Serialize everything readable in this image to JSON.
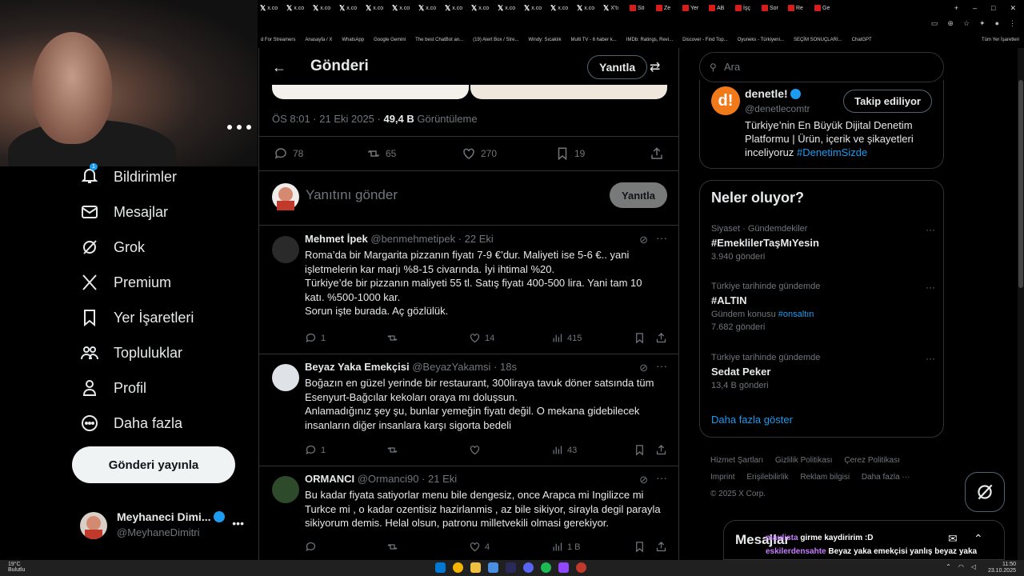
{
  "browser": {
    "tabs": [
      "x.co",
      "x.co",
      "x.co",
      "x.co",
      "x.co",
      "x.co",
      "x.co",
      "x.co",
      "x.co",
      "x.co",
      "x.co",
      "x.co",
      "x.co",
      "X'tı",
      "Sö",
      "Ze",
      "Yer",
      "AB",
      "İşç",
      "Sor",
      "Re",
      "Ge"
    ],
    "bookmarks": [
      "d For Streamers",
      "Anasayfa / X",
      "WhatsApp",
      "Google Gemini",
      "The best ChatBot an...",
      "(19) Alert Box / Stre...",
      "Windy: Sıcaklık",
      "Multi TV - 6 haber k...",
      "IMDb: Ratings, Revi...",
      "Discover - Find Top...",
      "Oyuneks - Türkiyeni...",
      "SEÇİM SONUÇLARI...",
      "ChatGPT"
    ],
    "all_bookmarks": "Tüm Yer İşaretleri"
  },
  "nav": {
    "items": [
      {
        "label": "Bildirimler",
        "badge": "1"
      },
      {
        "label": "Mesajlar"
      },
      {
        "label": "Grok"
      },
      {
        "label": "Premium"
      },
      {
        "label": "Yer İşaretleri"
      },
      {
        "label": "Topluluklar"
      },
      {
        "label": "Profil"
      },
      {
        "label": "Daha fazla"
      }
    ],
    "post_button": "Gönderi yayınla",
    "account": {
      "name": "Meyhaneci Dimi...",
      "handle": "@MeyhaneDimitri"
    }
  },
  "main": {
    "title": "Gönderi",
    "reply_chip": "Yanıtla",
    "meta_time": "ÖS 8:01 · 21 Eki 2025 · ",
    "meta_views": "49,4 B",
    "meta_views_label": " Görüntüleme",
    "actions": {
      "replies": "78",
      "reposts": "65",
      "likes": "270",
      "bookmarks": "19"
    },
    "reply_placeholder": "Yanıtını gönder",
    "reply_button": "Yanıtla",
    "tweets": [
      {
        "name": "Mehmet İpek",
        "handle": "@benmehmetipek · 22 Eki",
        "lines": [
          "Roma’da bir Margarita pizzanın fiyatı 7-9 €’dur. Maliyeti ise 5-6 €.. yani",
          "işletmelerin kar marjı %8-15 civarında. İyi ihtimal %20.",
          "Türkiye’de bir pizzanın maliyeti 55 tl. Satış fiyatı 400-500 lira. Yani tam 10",
          "katı. %500-1000 kar.",
          "Sorun işte burada. Aç gözlülük."
        ],
        "replies": "1",
        "reposts": "",
        "likes": "14",
        "views": "415"
      },
      {
        "name": "Beyaz Yaka Emekçisi",
        "handle": "@BeyazYakamsi · 18s",
        "lines": [
          "Boğazın en güzel yerinde bir restaurant, 300liraya tavuk döner satsında tüm",
          "Esenyurt-Bağcılar kekoları oraya mı doluşsun.",
          "Anlamadığınız şey şu, bunlar yemeğin fiyatı değil. O mekana gidebilecek",
          "insanların diğer insanlara karşı sigorta bedeli"
        ],
        "replies": "1",
        "reposts": "",
        "likes": "",
        "views": "43"
      },
      {
        "name": "ORMANCI",
        "handle": "@Ormanci90 · 21 Eki",
        "lines": [
          "Bu kadar fiyata satiyorlar menu bile dengesiz, once Arapca mi Ingilizce mi",
          "Turkce mi , o kadar ozentisiz hazirlanmis , az bile sikiyor, sirayla degil parayla",
          "sikiyorum demis. Helal olsun, patronu milletvekili olmasi gerekiyor."
        ],
        "replies": "",
        "reposts": "",
        "likes": "4",
        "views": "1 B"
      }
    ]
  },
  "right": {
    "search_placeholder": "Ara",
    "profile": {
      "name": "denetle!",
      "handle": "@denetlecomtr",
      "follow": "Takip ediliyor",
      "bio_lines": [
        "Türkiye’nin En Büyük Dijital Denetim",
        "Platformu | Ürün, içerik ve şikayetleri",
        "inceliyoruz "
      ],
      "bio_tag": "#DenetimSizde"
    },
    "trends_title": "Neler oluyor?",
    "trends": [
      {
        "context": "Siyaset · Gündemdekiler",
        "title": "#EmeklilerTaşMıYesin",
        "sub": "3.940 gönderi",
        "sub_prefix": ""
      },
      {
        "context": "Türkiye tarihinde gündemde",
        "title": "#ALTIN",
        "sub_prefix": "Gündem konusu ",
        "sub_link": "#onsaltın",
        "sub": "7.682 gönderi"
      },
      {
        "context": "Türkiye tarihinde gündemde",
        "title": "Sedat Peker",
        "sub": "13,4 B gönderi",
        "sub_prefix": ""
      }
    ],
    "show_more": "Daha fazla göster",
    "footer": [
      "Hizmet Şartları",
      "Gizlilik Politikası",
      "Çerez Politikası",
      "Imprint",
      "Erişilebilirlik",
      "Reklam bilgisi",
      "Daha fazla ···",
      "© 2025 X Corp."
    ]
  },
  "messages_drawer": {
    "title": "Mesajlar"
  },
  "chat_overlay": [
    {
      "user": "maulista",
      "msg": "girme kaydiririm :D"
    },
    {
      "user": "eskilerdensahte",
      "msg": "Beyaz yaka emekçisi yanlış beyaz yaka yalakası doğru"
    }
  ],
  "taskbar": {
    "weather_temp": "19°C",
    "weather_desc": "Bulutlu",
    "time": "11:50",
    "date": "23.10.2025"
  }
}
